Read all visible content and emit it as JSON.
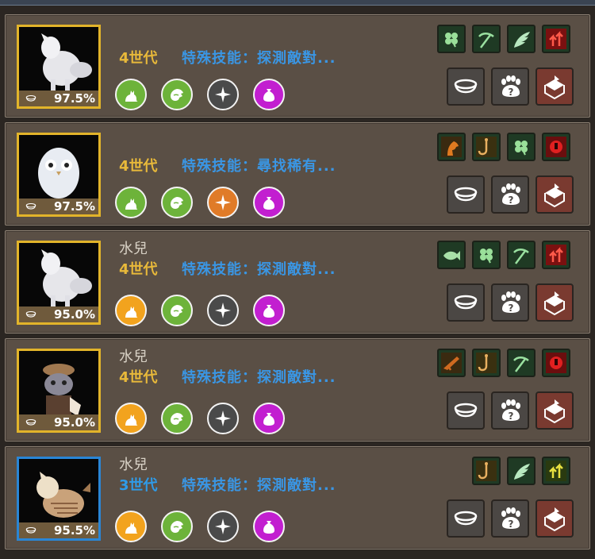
{
  "pets": [
    {
      "portrait_icon": "white-fluffy-creature-icon",
      "portrait_border": "#e2b42a",
      "hunger": "97.5%",
      "name": "",
      "generation": "4世代",
      "generation_color": "#e8b93a",
      "special_skill": "特殊技能：探測敵對...",
      "traits": [
        {
          "icon": "cat-icon",
          "color": "green"
        },
        {
          "icon": "hand-icon",
          "color": "green"
        },
        {
          "icon": "compass-icon",
          "color": "grey"
        },
        {
          "icon": "bag-icon",
          "color": "purple"
        }
      ],
      "skills": [
        "clover-icon",
        "pickaxe-icon",
        "wing-icon",
        "red-arrows-icon"
      ]
    },
    {
      "portrait_icon": "white-owl-icon",
      "portrait_border": "#e2b42a",
      "hunger": "97.5%",
      "name": "",
      "generation": "4世代",
      "generation_color": "#e8b93a",
      "special_skill": "特殊技能：尋找稀有...",
      "traits": [
        {
          "icon": "cat-icon",
          "color": "green"
        },
        {
          "icon": "hand-icon",
          "color": "green"
        },
        {
          "icon": "compass-icon",
          "color": "orange"
        },
        {
          "icon": "bag-icon",
          "color": "purple"
        }
      ],
      "skills": [
        "horse-icon",
        "fishhook-icon",
        "clover-icon",
        "red-fist-icon"
      ]
    },
    {
      "portrait_icon": "white-fluffy-creature-icon",
      "portrait_border": "#e2b42a",
      "hunger": "95.0%",
      "name": "水兒",
      "generation": "4世代",
      "generation_color": "#e8b93a",
      "special_skill": "特殊技能：探測敵對...",
      "traits": [
        {
          "icon": "cat-icon",
          "color": "yellow"
        },
        {
          "icon": "hand-icon",
          "color": "green"
        },
        {
          "icon": "compass-icon",
          "color": "grey"
        },
        {
          "icon": "bag-icon",
          "color": "purple"
        }
      ],
      "skills": [
        "fish-icon",
        "clover-icon",
        "pickaxe-icon",
        "red-arrows-icon"
      ]
    },
    {
      "portrait_icon": "hat-wearing-cat-icon",
      "portrait_border": "#e2b42a",
      "hunger": "95.0%",
      "name": "水兒",
      "generation": "4世代",
      "generation_color": "#e8b93a",
      "special_skill": "特殊技能：探測敵對...",
      "traits": [
        {
          "icon": "cat-icon",
          "color": "yellow"
        },
        {
          "icon": "hand-icon",
          "color": "green"
        },
        {
          "icon": "compass-icon",
          "color": "grey"
        },
        {
          "icon": "bag-icon",
          "color": "purple"
        }
      ],
      "skills": [
        "gun-icon",
        "fishhook-icon",
        "pickaxe-icon",
        "red-fist-icon"
      ]
    },
    {
      "portrait_icon": "tan-cat-icon",
      "portrait_border": "#2a86d6",
      "hunger": "95.5%",
      "name": "水兒",
      "generation": "3世代",
      "generation_color": "#2f9be8",
      "special_skill": "特殊技能：探測敵對...",
      "traits": [
        {
          "icon": "cat-icon",
          "color": "yellow"
        },
        {
          "icon": "hand-icon",
          "color": "green"
        },
        {
          "icon": "compass-icon",
          "color": "grey"
        },
        {
          "icon": "bag-icon",
          "color": "purple"
        }
      ],
      "skills": [
        "fishhook-icon",
        "wing-icon",
        "yellow-arrows-icon"
      ]
    }
  ],
  "actions": [
    {
      "icon": "feed-bowl-icon"
    },
    {
      "icon": "paw-question-icon"
    },
    {
      "icon": "box-return-icon"
    }
  ]
}
